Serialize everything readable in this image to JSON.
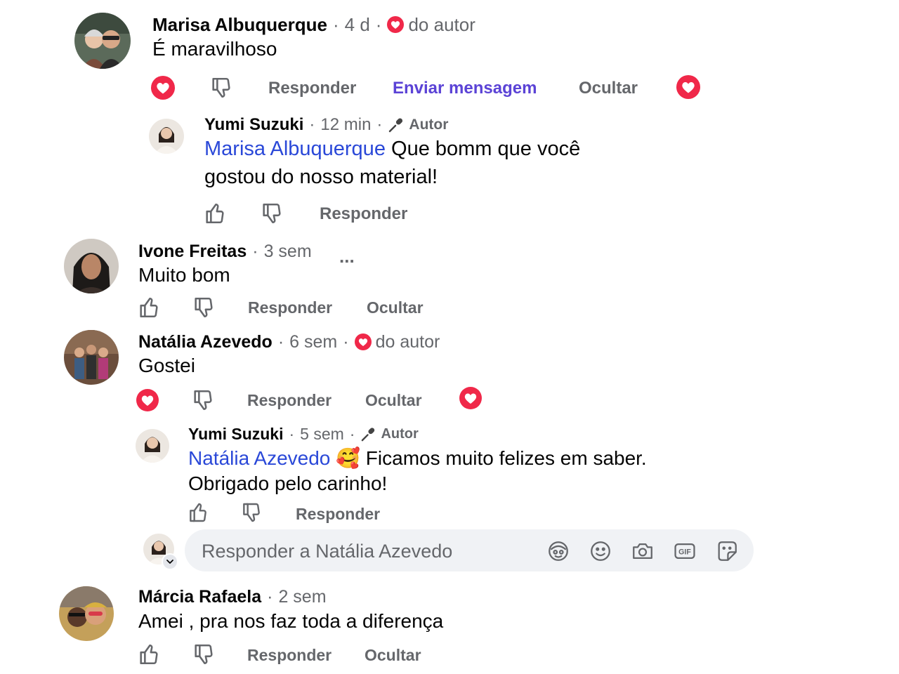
{
  "colors": {
    "heart": "#f02849",
    "muted": "#65676b",
    "mention": "#2a48d8",
    "message_link": "#5b43d6",
    "input_bg": "#f0f2f5"
  },
  "comments": [
    {
      "author": "Marisa Albuquerque",
      "time": "4 d",
      "badge": "do autor",
      "text": "É maravilhoso",
      "actions": {
        "reply": "Responder",
        "message": "Enviar mensagem",
        "hide": "Ocultar"
      },
      "reply": {
        "author": "Yumi Suzuki",
        "time": "12 min",
        "role": "Autor",
        "mention": "Marisa Albuquerque",
        "text_line1": "Que bomm que você",
        "text_line2": "gostou do nosso material!",
        "actions": {
          "reply": "Responder"
        }
      }
    },
    {
      "author": "Ivone Freitas",
      "time": "3 sem",
      "more": "...",
      "text": "Muito bom",
      "actions": {
        "reply": "Responder",
        "hide": "Ocultar"
      }
    },
    {
      "author": "Natália Azevedo",
      "time": "6 sem",
      "badge": "do autor",
      "text": "Gostei",
      "actions": {
        "reply": "Responder",
        "hide": "Ocultar"
      },
      "reply": {
        "author": "Yumi Suzuki",
        "time": "5 sem",
        "role": "Autor",
        "mention": "Natália Azevedo",
        "emoji": "🥰",
        "text_line1": "Ficamos muito felizes em saber.",
        "text_line2": "Obrigado pelo carinho!",
        "actions": {
          "reply": "Responder"
        }
      }
    },
    {
      "author": "Márcia Rafaela",
      "time": "2 sem",
      "text": "Amei , pra nos faz toda a diferença",
      "actions": {
        "reply": "Responder",
        "hide": "Ocultar"
      }
    }
  ],
  "reply_box": {
    "placeholder": "Responder a Natália Azevedo",
    "icons": [
      "avatar-sticker-icon",
      "emoji-icon",
      "camera-icon",
      "gif-icon",
      "sticker-icon"
    ],
    "gif_label": "GIF"
  }
}
